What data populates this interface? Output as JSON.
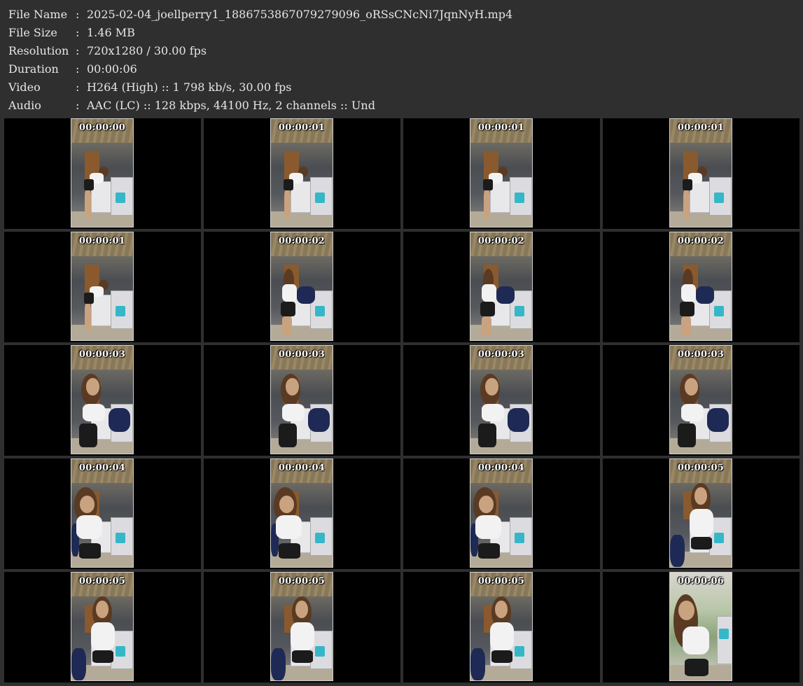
{
  "info": [
    {
      "key": "File Name",
      "value": "2025-02-04_joellperry1_1886753867079279096_oRSsCNcNi7JqnNyH.mp4"
    },
    {
      "key": "File Size",
      "value": "1.46 MB"
    },
    {
      "key": "Resolution",
      "value": "720x1280 / 30.00 fps"
    },
    {
      "key": "Duration",
      "value": "00:00:06"
    },
    {
      "key": "Video",
      "value": "H264 (High) :: 1 798 kb/s, 30.00 fps"
    },
    {
      "key": "Audio",
      "value": "AAC (LC) :: 128 kbps, 44100 Hz, 2 channels :: Und"
    }
  ],
  "separator": ":",
  "thumbnails": [
    {
      "time": "00:00:00",
      "scene": "s1"
    },
    {
      "time": "00:00:01",
      "scene": "s1"
    },
    {
      "time": "00:00:01",
      "scene": "s1"
    },
    {
      "time": "00:00:01",
      "scene": "s1"
    },
    {
      "time": "00:00:01",
      "scene": "s1"
    },
    {
      "time": "00:00:02",
      "scene": "s2"
    },
    {
      "time": "00:00:02",
      "scene": "s2"
    },
    {
      "time": "00:00:02",
      "scene": "s2"
    },
    {
      "time": "00:00:03",
      "scene": "s3"
    },
    {
      "time": "00:00:03",
      "scene": "s3"
    },
    {
      "time": "00:00:03",
      "scene": "s3"
    },
    {
      "time": "00:00:03",
      "scene": "s3"
    },
    {
      "time": "00:00:04",
      "scene": "s4"
    },
    {
      "time": "00:00:04",
      "scene": "s4"
    },
    {
      "time": "00:00:04",
      "scene": "s4"
    },
    {
      "time": "00:00:05",
      "scene": "s5"
    },
    {
      "time": "00:00:05",
      "scene": "s5"
    },
    {
      "time": "00:00:05",
      "scene": "s5"
    },
    {
      "time": "00:00:05",
      "scene": "s5"
    },
    {
      "time": "00:00:06",
      "scene": "s6"
    }
  ]
}
